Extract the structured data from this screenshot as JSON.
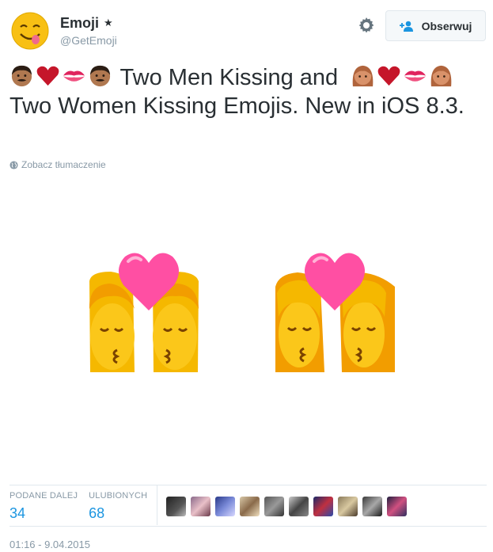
{
  "user": {
    "display_name": "Emoji",
    "verified_mark": "★",
    "handle": "@GetEmoji"
  },
  "follow_button": {
    "label": "Obserwuj"
  },
  "tweet": {
    "text_line1": "Two Men Kissing and",
    "text_rest": "Two Women Kissing Emojis. New in iOS 8.3.",
    "translate_label": "Zobacz tłumaczenie"
  },
  "stats": {
    "retweets_label": "PODANE DALEJ",
    "retweets_value": "34",
    "likes_label": "ULUBIONYCH",
    "likes_value": "68"
  },
  "timestamp": "01:16 - 9.04.2015",
  "colors": {
    "link_blue": "#1b95e0",
    "muted": "#8899a6",
    "text": "#292f33",
    "heart_red": "#c5162a",
    "heart_pink": "#ff4fa3",
    "emoji_yellow": "#f8c014"
  },
  "icons": [
    "smiling-face-avatar-icon",
    "gear-icon",
    "add-user-icon",
    "globe-icon",
    "man-face-icon",
    "heart-icon",
    "kiss-lips-icon",
    "woman-face-icon"
  ]
}
